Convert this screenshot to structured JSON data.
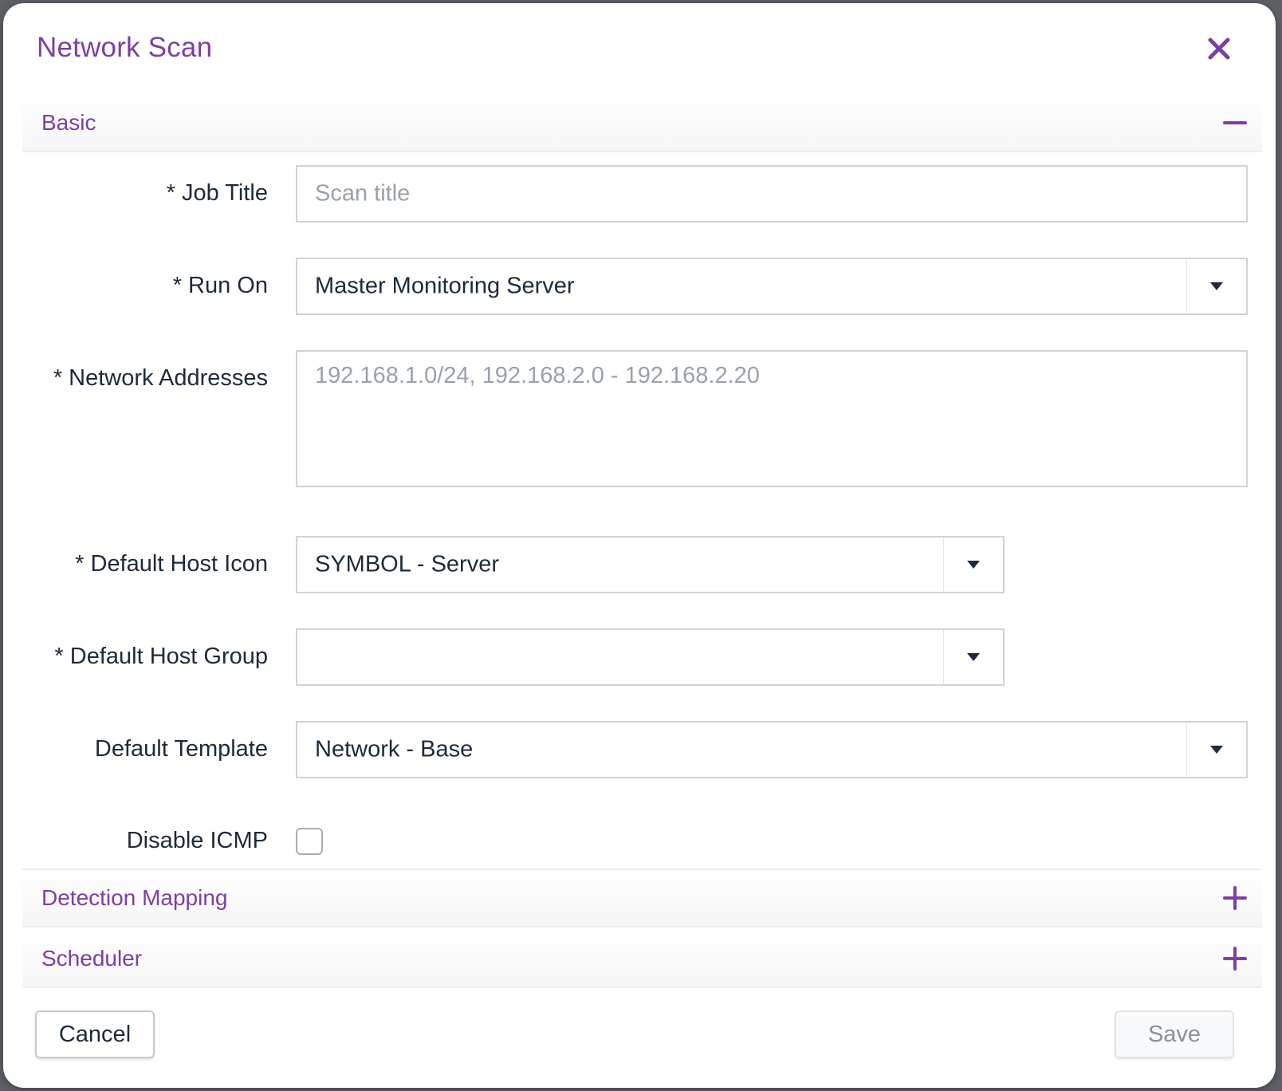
{
  "dialog": {
    "title": "Network Scan",
    "close_icon": "close-icon",
    "accent_color": "#7b3fa6"
  },
  "sections": {
    "basic": {
      "label": "Basic",
      "state": "expanded",
      "toggle_icon": "minus-icon"
    },
    "detection_mapping": {
      "label": "Detection Mapping",
      "state": "collapsed",
      "toggle_icon": "plus-icon"
    },
    "scheduler": {
      "label": "Scheduler",
      "state": "collapsed",
      "toggle_icon": "plus-icon"
    }
  },
  "form": {
    "job_title": {
      "label": "* Job Title",
      "value": "",
      "placeholder": "Scan title"
    },
    "run_on": {
      "label": "* Run On",
      "value": "Master Monitoring Server"
    },
    "network_addresses": {
      "label": "* Network Addresses",
      "value": "",
      "placeholder": "192.168.1.0/24, 192.168.2.0 - 192.168.2.20"
    },
    "default_host_icon": {
      "label": "* Default Host Icon",
      "value": "SYMBOL - Server"
    },
    "default_host_group": {
      "label": "* Default Host Group",
      "value": ""
    },
    "default_template": {
      "label": "Default Template",
      "value": "Network - Base"
    },
    "disable_icmp": {
      "label": "Disable ICMP",
      "checked": false
    }
  },
  "footer": {
    "cancel_label": "Cancel",
    "save_label": "Save",
    "save_enabled": false
  }
}
